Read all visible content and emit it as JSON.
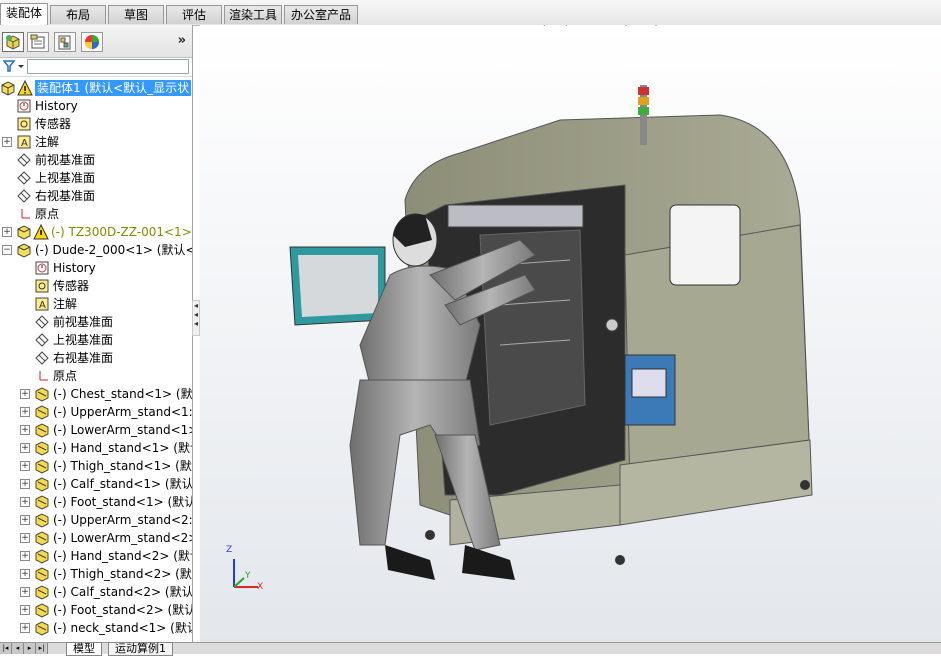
{
  "tabs": [
    "装配体",
    "布局",
    "草图",
    "评估",
    "渲染工具",
    "办公室产品"
  ],
  "feature_tree": {
    "root_label": "装配体1 (默认<默认_显示状",
    "items": [
      {
        "label": "History"
      },
      {
        "label": "传感器"
      },
      {
        "label": "注解"
      },
      {
        "label": "前视基准面"
      },
      {
        "label": "上视基准面"
      },
      {
        "label": "右视基准面"
      },
      {
        "label": "原点"
      },
      {
        "label": "(-) TZ300D-ZZ-001<1>"
      },
      {
        "label": "(-) Dude-2_000<1> (默认<"
      },
      {
        "label": "History"
      },
      {
        "label": "传感器"
      },
      {
        "label": "注解"
      },
      {
        "label": "前视基准面"
      },
      {
        "label": "上视基准面"
      },
      {
        "label": "右视基准面"
      },
      {
        "label": "原点"
      },
      {
        "label": "(-) Chest_stand<1> (默认"
      },
      {
        "label": "(-) UpperArm_stand<1:"
      },
      {
        "label": "(-) LowerArm_stand<1>"
      },
      {
        "label": "(-) Hand_stand<1> (默认"
      },
      {
        "label": "(-) Thigh_stand<1> (默认"
      },
      {
        "label": "(-) Calf_stand<1> (默认"
      },
      {
        "label": "(-) Foot_stand<1> (默认"
      },
      {
        "label": "(-) UpperArm_stand<2:"
      },
      {
        "label": "(-) LowerArm_stand<2>"
      },
      {
        "label": "(-) Hand_stand<2> (默认"
      },
      {
        "label": "(-) Thigh_stand<2> (默认"
      },
      {
        "label": "(-) Calf_stand<2> (默认"
      },
      {
        "label": "(-) Foot_stand<2> (默认"
      },
      {
        "label": "(-) neck_stand<1> (默认"
      }
    ]
  },
  "bottom_tabs": [
    "模型",
    "运动算例1"
  ],
  "triad": {
    "z": "Z",
    "y": "Y",
    "x": "X"
  },
  "colors": {
    "selection": "#3399ff",
    "machine": "#9fa08a",
    "accent": "#2e9aa0"
  }
}
